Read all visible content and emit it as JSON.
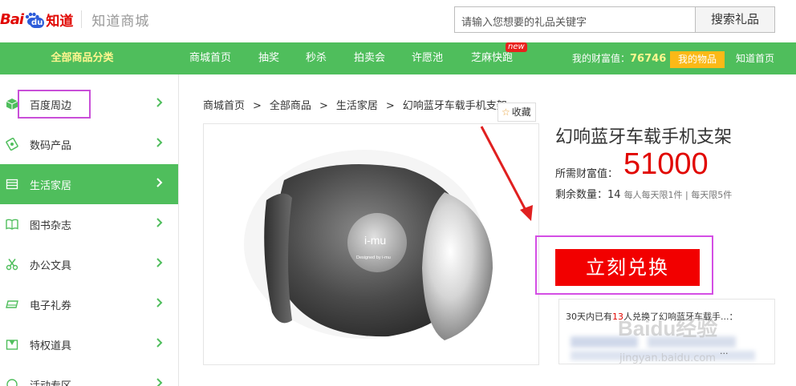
{
  "header": {
    "logo_bai": "Bai",
    "logo_du": "du",
    "logo_zhidao": "知道",
    "mall_name": "知道商城",
    "search_placeholder": "请输入您想要的礼品关键字",
    "search_button": "搜索礼品"
  },
  "nav": {
    "all_categories": "全部商品分类",
    "items": [
      "商城首页",
      "抽奖",
      "秒杀",
      "拍卖会",
      "许愿池",
      "芝麻快跑"
    ],
    "new_badge": "new",
    "wealth_label": "我的财富值：",
    "wealth_value": "76746",
    "my_items": "我的物品",
    "zhidao_home": "知道首页"
  },
  "sidebar": {
    "items": [
      {
        "label": "百度周边",
        "icon": "box-icon"
      },
      {
        "label": "数码产品",
        "icon": "digital-icon"
      },
      {
        "label": "生活家居",
        "icon": "home-icon",
        "active": true
      },
      {
        "label": "图书杂志",
        "icon": "book-icon"
      },
      {
        "label": "办公文具",
        "icon": "scissors-icon"
      },
      {
        "label": "电子礼券",
        "icon": "ticket-icon"
      },
      {
        "label": "特权道具",
        "icon": "privilege-icon"
      },
      {
        "label": "活动专区",
        "icon": "event-icon"
      }
    ]
  },
  "breadcrumb": [
    "商城首页",
    "全部商品",
    "生活家居",
    "幻响蓝牙车载手机支架"
  ],
  "favorite_label": "收藏",
  "product": {
    "title": "幻响蓝牙车载手机支架",
    "price_label": "所需财富值：",
    "price": "51000",
    "stock_label": "剩余数量：",
    "stock_value": "14",
    "limit_text": "每人每天限1件 | 每天限5件",
    "redeem_button": "立刻兑换",
    "image_brand": "i-mu",
    "image_caption": "Designed by i-mu"
  },
  "notice": {
    "prefix": "30天内已有",
    "count": "13",
    "suffix": "人兑换了幻响蓝牙车载手...：",
    "dots": "..."
  },
  "watermark": {
    "text": "Baidu经验",
    "url": "jingyan.baidu.com"
  },
  "colors": {
    "nav_green": "#4fbe5c",
    "price_red": "#e10601",
    "redeem_red": "#f20000",
    "highlight_magenta": "#d44ee5"
  }
}
